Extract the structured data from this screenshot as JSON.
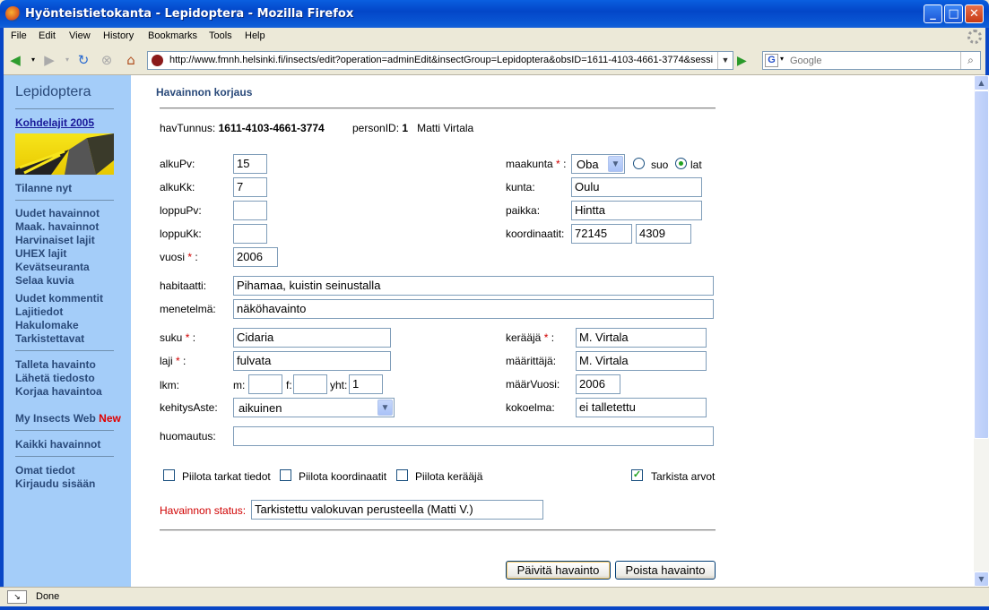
{
  "window": {
    "title": "Hyönteistietokanta - Lepidoptera - Mozilla Firefox"
  },
  "menu": [
    "File",
    "Edit",
    "View",
    "History",
    "Bookmarks",
    "Tools",
    "Help"
  ],
  "nav": {
    "url": "http://www.fmnh.helsinki.fi/insects/edit?operation=adminEdit&insectGroup=Lepidoptera&obsID=1611-4103-4661-3774&sessi",
    "search_placeholder": "Google"
  },
  "sidebar": {
    "title": "Lepidoptera",
    "featured_link": "Kohdelajit 2005",
    "status_link": "Tilanne nyt",
    "group1": [
      "Uudet havainnot",
      "Maak. havainnot",
      "Harvinaiset lajit",
      "UHEX lajit",
      "Kevätseuranta",
      "Selaa kuvia"
    ],
    "group2": [
      "Uudet kommentit",
      "Lajitiedot",
      "Hakulomake",
      "Tarkistettavat"
    ],
    "group3": [
      "Talleta havainto",
      "Lähetä tiedosto",
      "Korjaa havaintoa"
    ],
    "my_insects": "My Insects Web",
    "new_badge": "New",
    "all_obs": "Kaikki havainnot",
    "group5": [
      "Omat tiedot",
      "Kirjaudu sisään"
    ]
  },
  "form": {
    "heading": "Havainnon korjaus",
    "havTunnus_label": "havTunnus:",
    "havTunnus": "1611-4103-4661-3774",
    "personID_label": "personID:",
    "personID": "1",
    "person_name": "Matti Virtala",
    "alkuPv_label": "alkuPv:",
    "alkuPv": "15",
    "alkuKk_label": "alkuKk:",
    "alkuKk": "7",
    "loppuPv_label": "loppuPv:",
    "loppuPv": "",
    "loppuKk_label": "loppuKk:",
    "loppuKk": "",
    "vuosi_label": "vuosi",
    "vuosi": "2006",
    "maakunta_label": "maakunta",
    "maakunta": "Oba",
    "suo_label": "suo",
    "lat_label": "lat",
    "kunta_label": "kunta:",
    "kunta": "Oulu",
    "paikka_label": "paikka:",
    "paikka": "Hintta",
    "koordinaatit_label": "koordinaatit:",
    "koord_n": "72145",
    "koord_e": "4309",
    "habitaatti_label": "habitaatti:",
    "habitaatti": "Pihamaa, kuistin seinustalla",
    "menetelma_label": "menetelmä:",
    "menetelma": "näköhavainto",
    "suku_label": "suku",
    "suku": "Cidaria",
    "laji_label": "laji",
    "laji": "fulvata",
    "keraaja_label": "kerääjä",
    "keraaja": "M. Virtala",
    "maarittaja_label": "määrittäjä:",
    "maarittaja": "M. Virtala",
    "lkm_label": "lkm:",
    "m_label": "m:",
    "m": "",
    "f_label": "f:",
    "f": "",
    "yht_label": "yht:",
    "yht": "1",
    "maarVuosi_label": "määrVuosi:",
    "maarVuosi": "2006",
    "kehitysAste_label": "kehitysAste:",
    "kehitysAste": "aikuinen",
    "kokoelma_label": "kokoelma:",
    "kokoelma": "ei talletettu",
    "huomautus_label": "huomautus:",
    "huomautus": "",
    "hide_details": "Piilota tarkat tiedot",
    "hide_coords": "Piilota koordinaatit",
    "hide_collector": "Piilota kerääjä",
    "check_values": "Tarkista arvot",
    "status_label": "Havainnon status:",
    "status": "Tarkistettu valokuvan perusteella (Matti V.)",
    "update_button": "Päivitä havainto",
    "delete_button": "Poista havainto",
    "req_mark": "*",
    "colon": ":"
  },
  "statusbar": {
    "text": "Done"
  }
}
